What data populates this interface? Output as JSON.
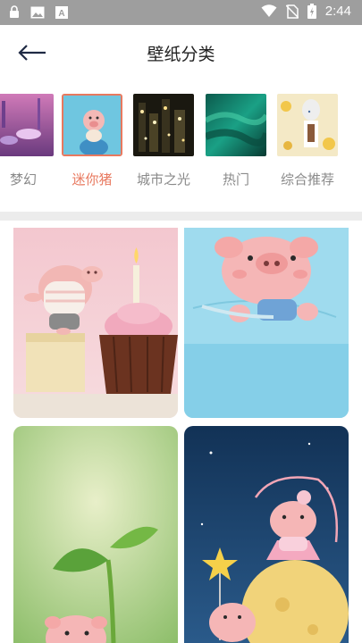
{
  "status_bar": {
    "time": "2:44",
    "left_icons": [
      "lock-icon",
      "image-icon",
      "font-icon"
    ],
    "right_icons": [
      "wifi-icon",
      "no-sim-icon",
      "battery-icon"
    ]
  },
  "header": {
    "title": "壁纸分类",
    "back_icon": "arrow-left-icon"
  },
  "categories": [
    {
      "label": "梦幻",
      "active": false
    },
    {
      "label": "迷你猪",
      "active": true
    },
    {
      "label": "城市之光",
      "active": false
    },
    {
      "label": "热门",
      "active": false
    },
    {
      "label": "综合推荐",
      "active": false
    }
  ],
  "colors": {
    "accent": "#e8795f",
    "status_bar": "#9e9e9e",
    "label_inactive": "#8a8a8a",
    "divider": "#ececec"
  },
  "wallpapers": [
    {
      "subject": "pig-with-cupcake"
    },
    {
      "subject": "pig-in-pocket"
    },
    {
      "subject": "pig-with-sprout"
    },
    {
      "subject": "pig-ballerina-moon"
    }
  ]
}
